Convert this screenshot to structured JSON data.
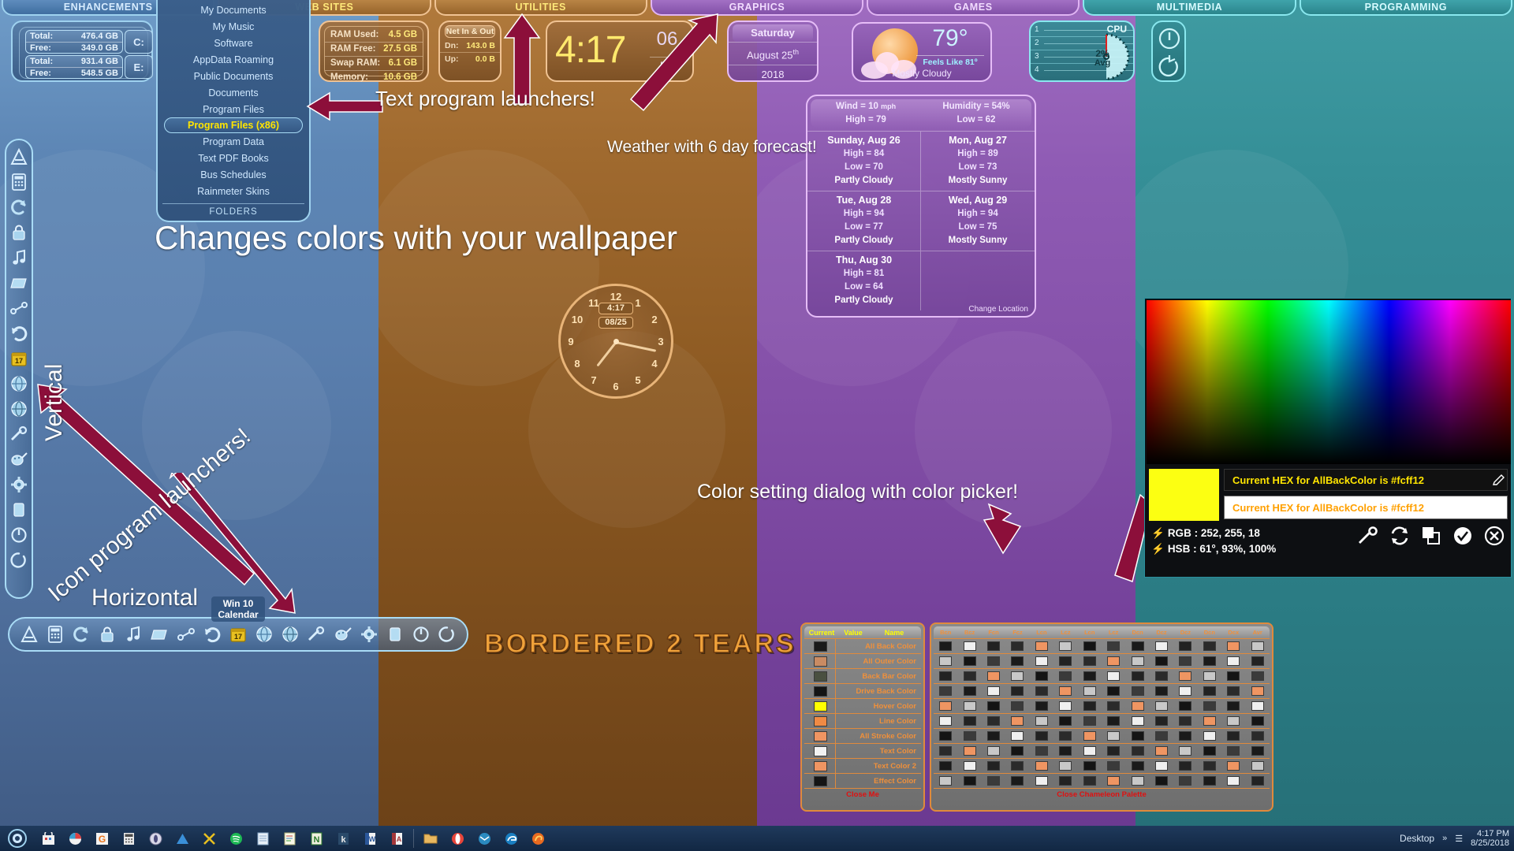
{
  "topbars": [
    {
      "label": "ENHANCEMENTS",
      "theme": "blue"
    },
    {
      "label": "WEB SITES",
      "theme": "orange"
    },
    {
      "label": "UTILITIES",
      "theme": "orange"
    },
    {
      "label": "GRAPHICS",
      "theme": "purple"
    },
    {
      "label": "GAMES",
      "theme": "purple"
    },
    {
      "label": "MULTIMEDIA",
      "theme": "teal"
    },
    {
      "label": "PROGRAMMING",
      "theme": "teal"
    }
  ],
  "drives": {
    "rows": [
      {
        "total_label": "Total:",
        "total_value": "476.4 GB",
        "free_label": "Free:",
        "free_value": "349.0 GB",
        "letter": "C:"
      },
      {
        "total_label": "Total:",
        "total_value": "931.4 GB",
        "free_label": "Free:",
        "free_value": "548.5 GB",
        "letter": "E:"
      }
    ]
  },
  "folder_menu": {
    "footer": "FOLDERS",
    "items": [
      {
        "label": "My Documents",
        "selected": false
      },
      {
        "label": "My Music",
        "selected": false
      },
      {
        "label": "Software",
        "selected": false
      },
      {
        "label": "AppData Roaming",
        "selected": false
      },
      {
        "label": "Public Documents",
        "selected": false
      },
      {
        "label": "Documents",
        "selected": false
      },
      {
        "label": "Program Files",
        "selected": false
      },
      {
        "label": "Program Files (x86)",
        "selected": true
      },
      {
        "label": "Program Data",
        "selected": false
      },
      {
        "label": "Text PDF Books",
        "selected": false
      },
      {
        "label": "Bus Schedules",
        "selected": false
      },
      {
        "label": "Rainmeter Skins",
        "selected": false
      }
    ]
  },
  "ram": {
    "rows": [
      {
        "key": "RAM Used:",
        "value": "4.5 GB"
      },
      {
        "key": "RAM Free:",
        "value": "27.5 GB"
      },
      {
        "key": "Swap RAM:",
        "value": "6.1 GB"
      },
      {
        "key": "Memory:",
        "value": "10.6 GB"
      }
    ]
  },
  "net": {
    "title": "Net In & Out",
    "rows": [
      {
        "key": "Dn:",
        "value": "143.0 B"
      },
      {
        "key": "Up:",
        "value": "0.0 B"
      }
    ]
  },
  "clock": {
    "time": "4:17",
    "seconds": "06",
    "ampm": "PM"
  },
  "date": {
    "weekday": "Saturday",
    "monthday": "August 25",
    "ordinal": "th",
    "year": "2018"
  },
  "weather_now": {
    "temp": "79°",
    "feels_like": "Feels Like 81º",
    "condition": "Mostly Cloudy"
  },
  "cpu": {
    "label": "CPU",
    "cores": [
      "1",
      "2",
      "3",
      "4"
    ],
    "usage": "2%",
    "usage_suffix": "Avg"
  },
  "power": {
    "power_icon": "power-icon",
    "restart_icon": "restart-icon"
  },
  "forecast": {
    "wind_label": "Wind =",
    "wind_value": "10",
    "wind_unit": "mph",
    "humidity_label": "Humidity =",
    "humidity_value": "54%",
    "high_label": "High  =",
    "high_value": "79",
    "low_label": "Low  =",
    "low_value": "62",
    "change_location": "Change Location",
    "days": [
      {
        "day": "Sunday,  Aug 26",
        "high": "High = 84",
        "low": "Low = 70",
        "cond": "Partly Cloudy"
      },
      {
        "day": "Mon,  Aug 27",
        "high": "High = 89",
        "low": "Low = 73",
        "cond": "Mostly Sunny"
      },
      {
        "day": "Tue,  Aug 28",
        "high": "High = 94",
        "low": "Low = 77",
        "cond": "Partly Cloudy"
      },
      {
        "day": "Wed,  Aug 29",
        "high": "High = 94",
        "low": "Low = 75",
        "cond": "Mostly Sunny"
      },
      {
        "day": "Thu,  Aug 30",
        "high": "High = 81",
        "low": "Low = 64",
        "cond": "Partly Cloudy"
      }
    ]
  },
  "analog_clock": {
    "time": "4:17",
    "date": "08/25",
    "numbers": [
      "12",
      "1",
      "2",
      "3",
      "4",
      "5",
      "6",
      "7",
      "8",
      "9",
      "10",
      "11"
    ]
  },
  "annotations": [
    {
      "id": "text-launchers",
      "text": "Text program launchers!"
    },
    {
      "id": "weather-forecast",
      "text": "Weather with 6 day forecast!"
    },
    {
      "id": "changes-colors",
      "text": "Changes colors with your wallpaper"
    },
    {
      "id": "vertical",
      "text": "Vertical"
    },
    {
      "id": "icon-launchers",
      "text": "Icon program launchers!"
    },
    {
      "id": "horizontal",
      "text": "Horizontal"
    },
    {
      "id": "color-dialog",
      "text": "Color setting dialog with color picker!"
    }
  ],
  "win10_calendar": {
    "line1": "Win 10",
    "line2": "Calendar"
  },
  "brand_logo": "BORDERED 2 TEARS",
  "color_picker": {
    "hex_readout": "Current HEX for AllBackColor is #fcff12",
    "hex_input_value": "Current HEX for AllBackColor is #fcff12",
    "swatch_hex": "#fcff12",
    "rgb_label": "RGB :",
    "rgb_value": "252, 255, 18",
    "hsb_label": "HSB :",
    "hsb_value": "61°, 93%, 100%",
    "tools": [
      "eyedropper-icon",
      "refresh-icon",
      "copy-icon",
      "confirm-icon",
      "close-icon"
    ]
  },
  "color_settings": {
    "headers_left": [
      "Current",
      "Value",
      "Name"
    ],
    "close_left": "Close Me",
    "close_right": "Close Chameleon Palette",
    "headers_right": [
      "Bcn",
      "Bcz",
      "Fcn",
      "Fcz",
      "Lcn",
      "Lcz",
      "Lcn",
      "Lcz",
      "Dcn",
      "Dcz",
      "Dcz",
      "Dcn",
      "Dcx",
      "Avr"
    ],
    "rows": [
      {
        "name": "All Back Color",
        "color": "#1a1a1a"
      },
      {
        "name": "All Outer Color",
        "color": "#c98b63"
      },
      {
        "name": "Back Bar Color",
        "color": "#4a5040"
      },
      {
        "name": "Drive Back Color",
        "color": "#141414"
      },
      {
        "name": "Hover Color",
        "color": "#ffff00"
      },
      {
        "name": "Line Color",
        "color": "#f08a44"
      },
      {
        "name": "All Stroke Color",
        "color": "#ef9562"
      },
      {
        "name": "Text Color",
        "color": "#f2f2f2"
      },
      {
        "name": "Text Color 2",
        "color": "#ef9562"
      },
      {
        "name": "Effect Color",
        "color": "#141414"
      }
    ]
  },
  "taskbar": {
    "start_icon": "start-orb-icon",
    "icons": [
      "store-icon",
      "photos-icon",
      "office-icon",
      "calculator-icon",
      "zip-icon",
      "blue-triangle-icon",
      "tools-icon",
      "spotify-icon",
      "notepad-icon",
      "editor-icon",
      "notes-icon",
      "kindle-icon",
      "word-icon",
      "access-icon",
      "explorer-icon",
      "opera-icon",
      "mail-icon",
      "edge-icon",
      "firefox-icon"
    ],
    "desktop_label": "Desktop",
    "overflow_label": "»",
    "tray_time": "4:17 PM",
    "tray_date": "8/25/2018"
  },
  "vertical_dock": {
    "icons": [
      "triangle-icon",
      "calculator-icon",
      "refresh-swirl-icon",
      "lock-icon",
      "music-note-icon",
      "folder-icon",
      "link-icon",
      "undo-icon",
      "calendar-icon",
      "globe-icon",
      "globe2-icon",
      "eyedropper-icon",
      "paint-icon",
      "gear-icon",
      "monitor-icon",
      "power-icon",
      "restart-icon"
    ]
  },
  "horizontal_dock": {
    "icons": [
      "triangle-icon",
      "calculator-icon",
      "refresh-swirl-icon",
      "lock-icon",
      "music-note-icon",
      "folder-icon",
      "link-icon",
      "undo-icon",
      "calendar-icon",
      "globe-icon",
      "globe2-icon",
      "eyedropper-icon",
      "paint-icon",
      "gear-icon",
      "monitor-icon",
      "power-icon",
      "restart-icon"
    ]
  }
}
